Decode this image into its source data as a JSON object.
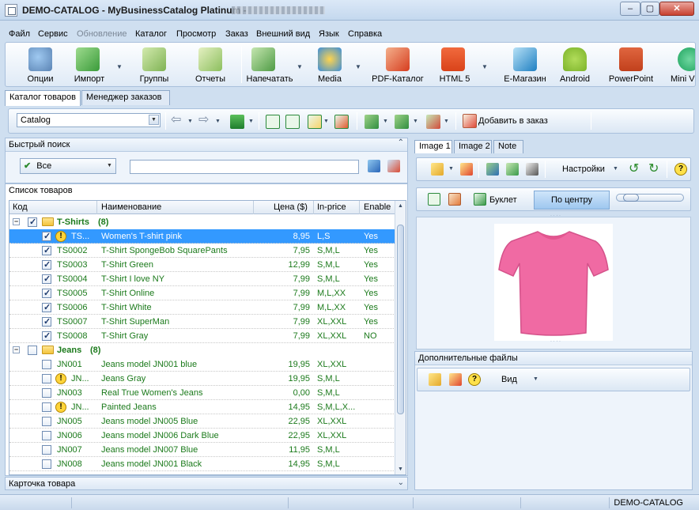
{
  "window": {
    "title": "DEMO-CATALOG - MyBusinessCatalog Platinum -",
    "minimize": "‒",
    "maximize": "▢",
    "close": "✕"
  },
  "menu": [
    "Файл",
    "Сервис",
    "Обновление",
    "Каталог",
    "Просмотр",
    "Заказ",
    "Внешний вид",
    "Язык",
    "Справка"
  ],
  "main_toolbar": {
    "options": "Опции",
    "import": "Импорт",
    "groups": "Группы",
    "reports": "Отчеты",
    "print": "Напечатать",
    "media": "Media",
    "pdf": "PDF-Каталог",
    "html5": "HTML 5",
    "eshop": "E-Магазин",
    "android": "Android",
    "powerpoint": "PowerPoint",
    "mini": "Mini V"
  },
  "tabs": {
    "catalog": "Каталог товаров",
    "orders": "Менеджер заказов"
  },
  "catalog_toolbar": {
    "catalog_select": "Catalog",
    "add_to_order": "Добавить в заказ"
  },
  "quick_search": {
    "title": "Быстрый поиск",
    "filter": "Все",
    "query": ""
  },
  "product_list": {
    "title": "Список товаров",
    "columns": {
      "code": "Код",
      "name": "Наименование",
      "price": "Цена ($)",
      "inprice": "In-price",
      "enable": "Enable"
    },
    "groups": [
      {
        "name": "T-Shirts",
        "count": "(8)"
      },
      {
        "name": "Jeans",
        "count": "(8)"
      }
    ],
    "rows": [
      {
        "code": "TS...",
        "name": "Women's T-shirt pink",
        "price": "8,95",
        "inprice": "L,S",
        "enable": "Yes"
      },
      {
        "code": "TS0002",
        "name": "T-Shirt SpongeBob SquarePants",
        "price": "7,95",
        "inprice": "S,M,L",
        "enable": "Yes"
      },
      {
        "code": "TS0003",
        "name": "T-Shirt Green",
        "price": "12,99",
        "inprice": "S,M,L",
        "enable": "Yes"
      },
      {
        "code": "TS0004",
        "name": "T-Shirt I love NY",
        "price": "7,99",
        "inprice": "S,M,L",
        "enable": "Yes"
      },
      {
        "code": "TS0005",
        "name": "T-Shirt Online",
        "price": "7,99",
        "inprice": "M,L,XX",
        "enable": "Yes"
      },
      {
        "code": "TS0006",
        "name": "T-Shirt White",
        "price": "7,99",
        "inprice": "M,L,XX",
        "enable": "Yes"
      },
      {
        "code": "TS0007",
        "name": "T-Shirt SuperMan",
        "price": "7,99",
        "inprice": "XL,XXL",
        "enable": "Yes"
      },
      {
        "code": "TS0008",
        "name": "T-Shirt Gray",
        "price": "7,99",
        "inprice": "XL,XXL",
        "enable": "NO"
      },
      {
        "code": "JN001",
        "name": "Jeans model JN001 blue",
        "price": "19,95",
        "inprice": "XL,XXL",
        "enable": ""
      },
      {
        "code": "JN...",
        "name": "Jeans Gray",
        "price": "19,95",
        "inprice": "S,M,L",
        "enable": ""
      },
      {
        "code": "JN003",
        "name": "Real True Women's Jeans",
        "price": "0,00",
        "inprice": "S,M,L",
        "enable": ""
      },
      {
        "code": "JN...",
        "name": "Painted Jeans",
        "price": "14,95",
        "inprice": "S,M,L,X...",
        "enable": ""
      },
      {
        "code": "JN005",
        "name": "Jeans model JN005 Blue",
        "price": "22,95",
        "inprice": "XL,XXL",
        "enable": ""
      },
      {
        "code": "JN006",
        "name": "Jeans model JN006 Dark Blue",
        "price": "22,95",
        "inprice": "XL,XXL",
        "enable": ""
      },
      {
        "code": "JN007",
        "name": "Jeans model JN007 Blue",
        "price": "11,95",
        "inprice": "S,M,L",
        "enable": ""
      },
      {
        "code": "JN008",
        "name": "Jeans model JN001 Black",
        "price": "14,95",
        "inprice": "S,M,L",
        "enable": ""
      }
    ]
  },
  "product_card": "Карточка товара",
  "image_panel": {
    "tabs": [
      "Image 1",
      "Image 2",
      "Note"
    ],
    "settings": "Настройки",
    "booklet": "Буклет",
    "center": "По центру"
  },
  "extra_files": {
    "title": "Дополнительные файлы",
    "view": "Вид"
  },
  "status": {
    "catalog": "DEMO-CATALOG"
  },
  "colors": {
    "group_text": "#1b7a1b",
    "selection": "#3399ff",
    "shirt": "#f06aa3"
  }
}
